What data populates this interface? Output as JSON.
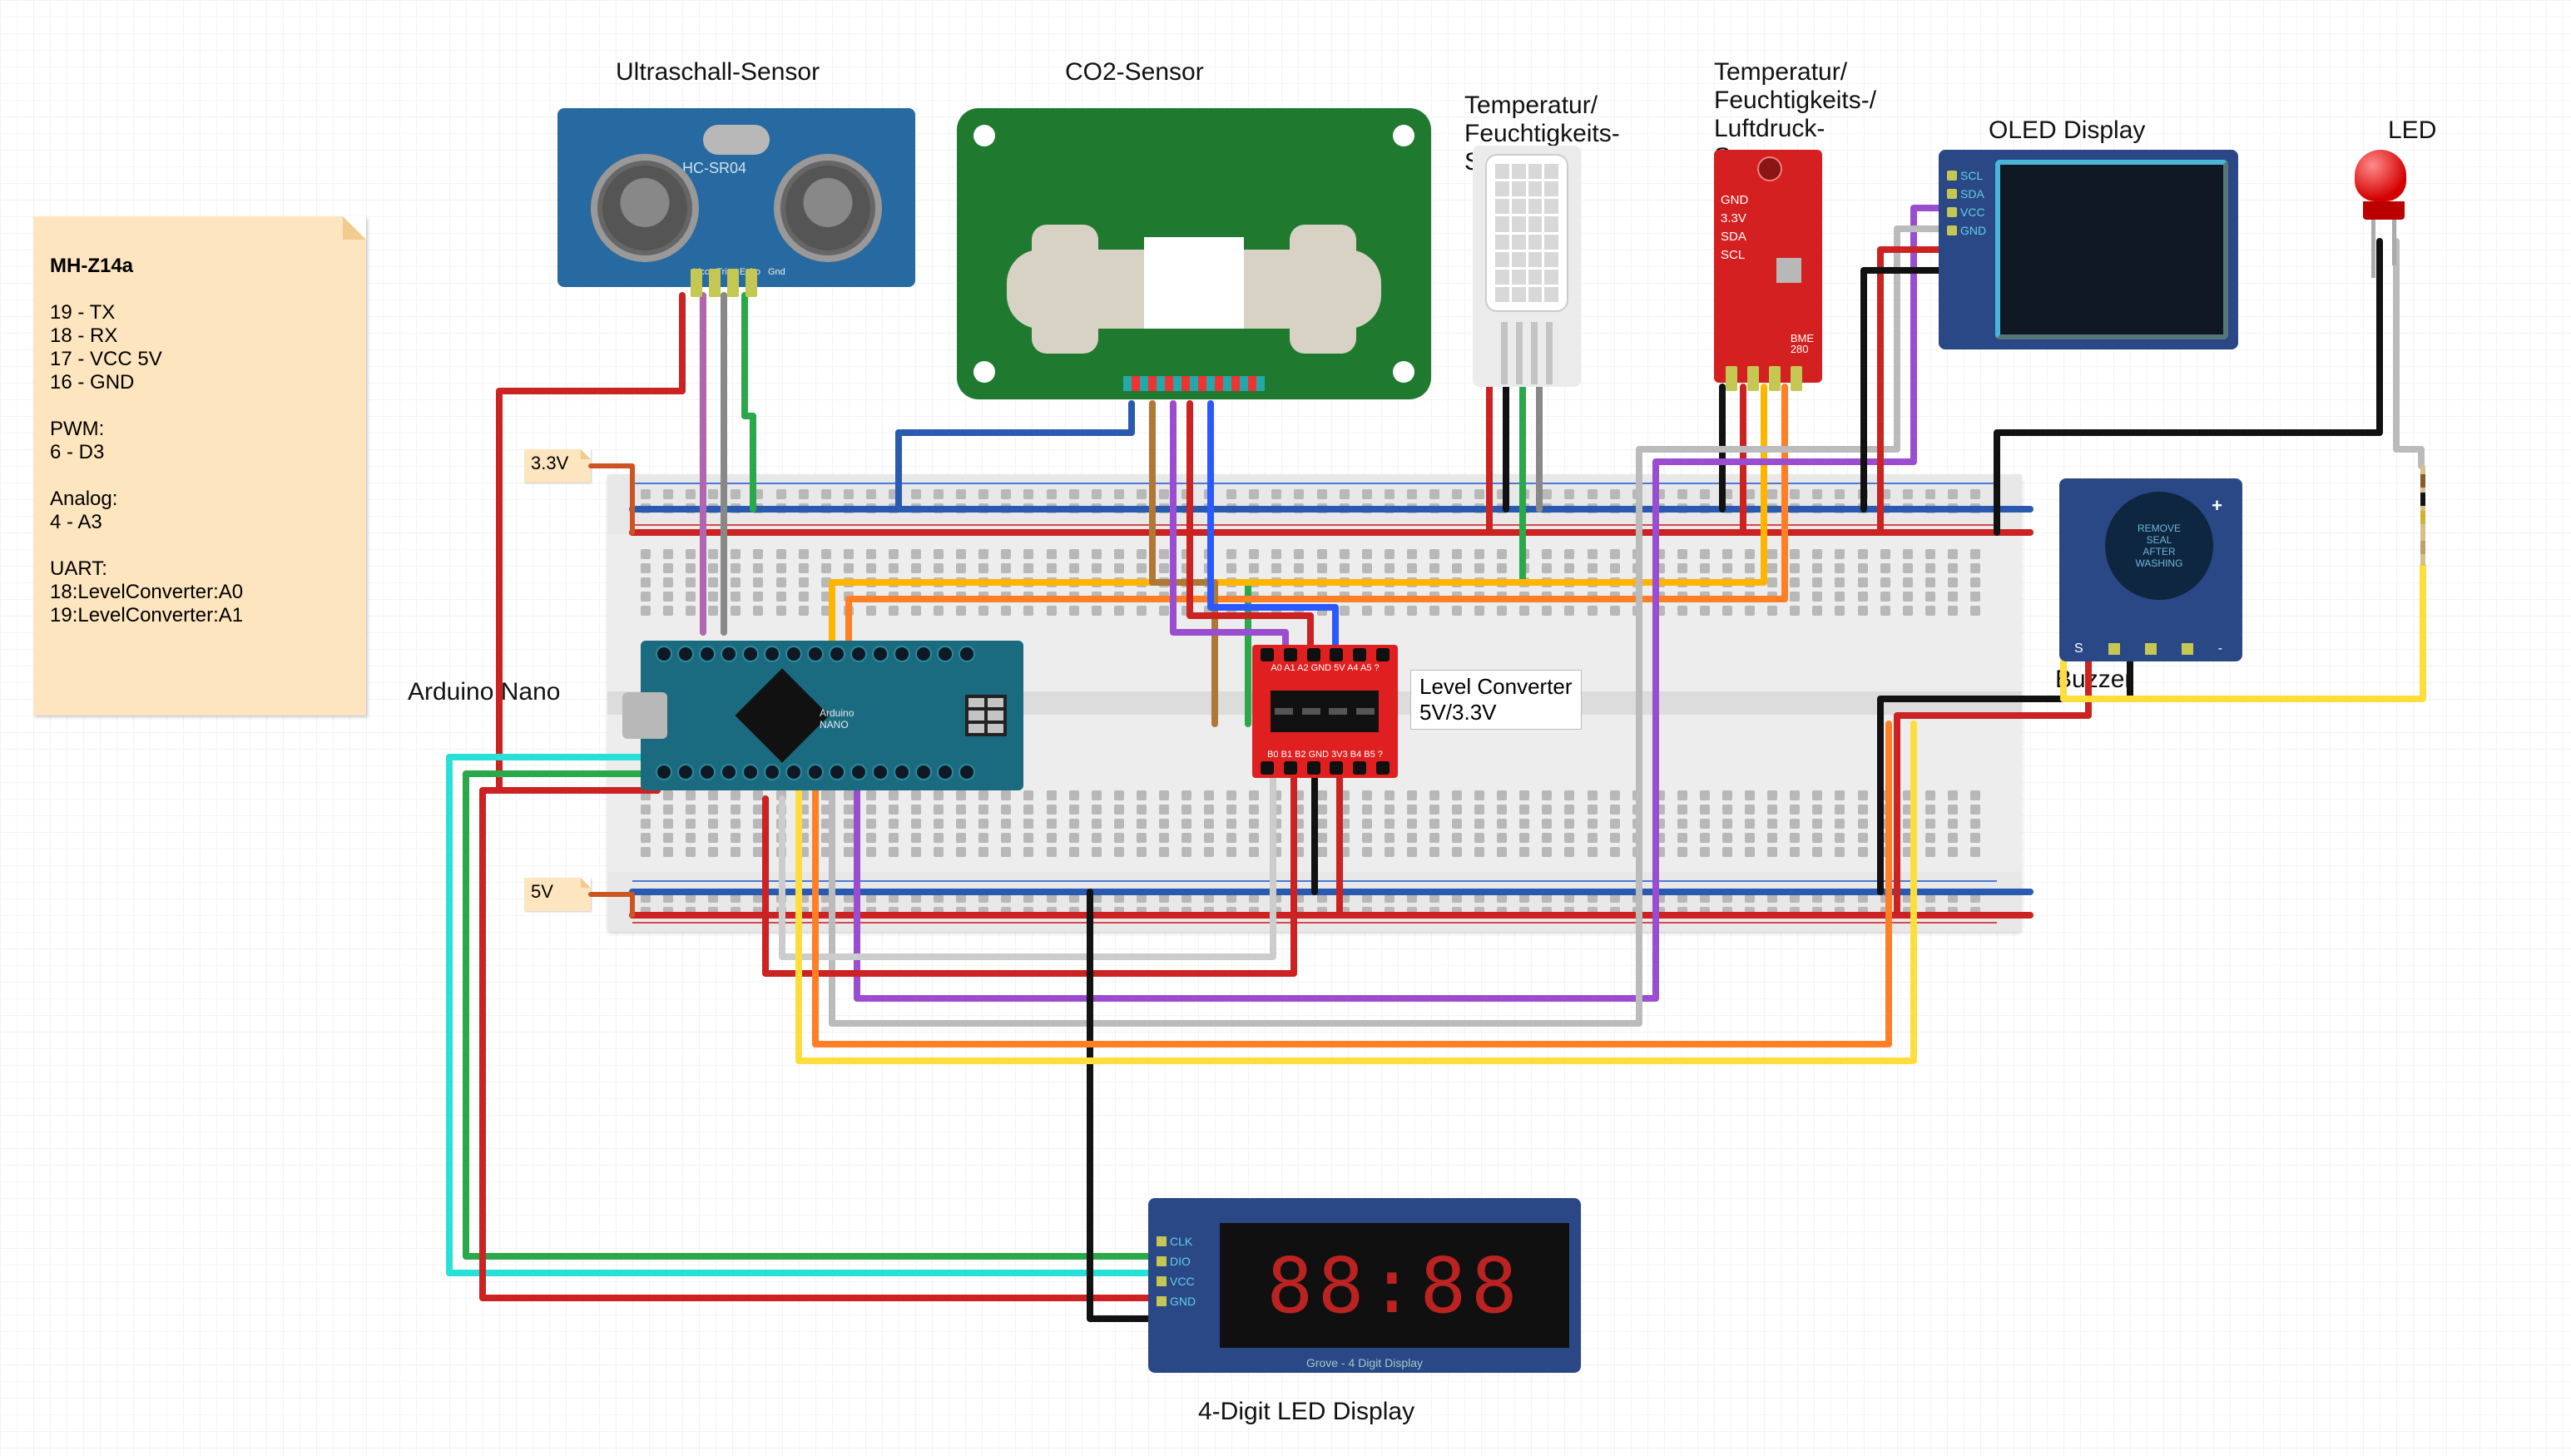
{
  "labels": {
    "ultrasonic": "Ultraschall-Sensor",
    "co2": "CO2-Sensor",
    "dht": "Temperatur/\nFeuchtigkeits-\nSensor",
    "bme": "Temperatur/\nFeuchtigkeits-/\nLuftdruck-\nSensor",
    "oled": "OLED Display",
    "led": "LED",
    "buzzer": "Buzzer",
    "nano": "Arduino Nano",
    "level_converter": "Level Converter\n5V/3.3V",
    "four_digit": "4-Digit LED Display"
  },
  "tags": {
    "v33": "3.3V",
    "v5": "5V"
  },
  "note": {
    "title": "MH-Z14a",
    "lines": [
      "19 - TX",
      "18 - RX",
      "17 - VCC 5V",
      "16 - GND",
      "",
      "PWM:",
      "6 - D3",
      "",
      "Analog:",
      "4 - A3",
      "",
      "UART:",
      "18:LevelConverter:A0",
      "19:LevelConverter:A1"
    ]
  },
  "ultrasonic": {
    "model": "HC-SR04",
    "pins": [
      "Vcc",
      "Trig",
      "Echo",
      "Gnd"
    ]
  },
  "bme": {
    "pins": [
      "GND",
      "3.3V",
      "SDA",
      "SCL"
    ],
    "chip": "BME\n280"
  },
  "oled": {
    "pins": [
      "SCL",
      "SDA",
      "VCC",
      "GND"
    ]
  },
  "buzzer": {
    "seal_text": "REMOVE\nSEAL\nAFTER\nWASHING",
    "pins": [
      "S",
      "",
      "-"
    ]
  },
  "level_converter": {
    "top_silk": "A0 A1 A2 GND 5V A4 A5 ?",
    "bot_silk": "B0 B1 B2 GND 3V3 B4 B5 ?"
  },
  "four_digit": {
    "pins": [
      "CLK",
      "DIO",
      "VCC",
      "GND"
    ],
    "value": "88:88",
    "silk": "Grove - 4 Digit Display"
  },
  "nano": {
    "label": "Arduino\nNANO"
  },
  "resistor": {
    "bands": [
      "#8a5a2b",
      "#111",
      "#d4af37",
      "#c0a060"
    ]
  }
}
